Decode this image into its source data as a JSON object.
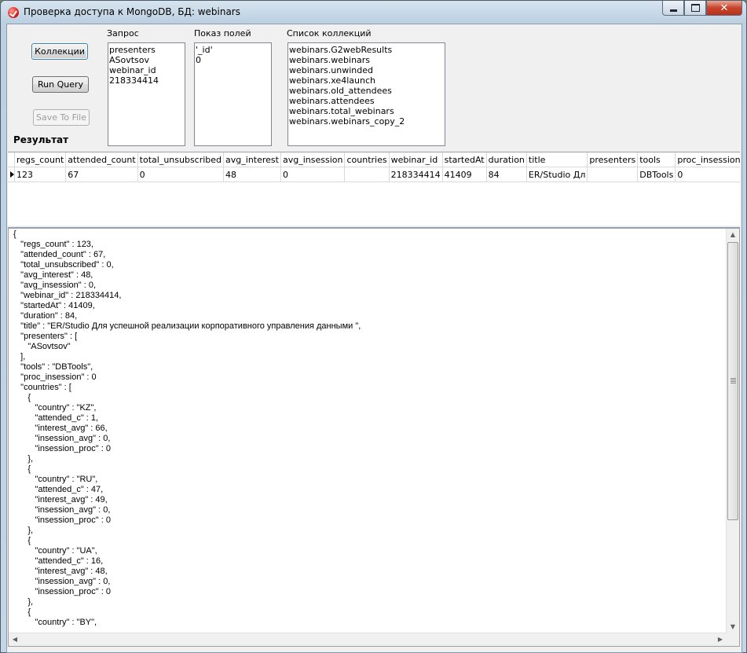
{
  "window": {
    "title": "Проверка доступа к MongoDB, БД: webinars",
    "controls": {
      "minimize_icon": "minimize-icon",
      "maximize_icon": "maximize-icon",
      "close_icon": "close-icon",
      "close_glyph": "✕"
    }
  },
  "buttons": {
    "collections": "Коллекции",
    "run_query": "Run Query",
    "save_to_file": "Save To File"
  },
  "query": {
    "label": "Запрос",
    "lines": [
      "presenters",
      "ASovtsov",
      "webinar_id",
      "218334414"
    ]
  },
  "fields": {
    "label": "Показ полей",
    "lines": [
      "'_id'",
      "0"
    ]
  },
  "collections": {
    "label": "Список  коллекций",
    "items": [
      "webinars.G2webResults",
      "webinars.webinars",
      "webinars.unwinded",
      "webinars.xe4launch",
      "webinars.old_attendees",
      "webinars.attendees",
      "webinars.total_webinars",
      "webinars.webinars_copy_2"
    ]
  },
  "result": {
    "label": "Результат",
    "columns": [
      "regs_count",
      "attended_count",
      "total_unsubscribed",
      "avg_interest",
      "avg_insession",
      "countries",
      "webinar_id",
      "startedAt",
      "duration",
      "title",
      "presenters",
      "tools",
      "proc_insession"
    ],
    "rows": [
      [
        "123",
        "67",
        "0",
        "48",
        "0",
        "",
        "218334414",
        "41409",
        "84",
        "ER/Studio Дл",
        "",
        "DBTools",
        "0"
      ]
    ]
  },
  "json_lines": [
    "{",
    "   \"regs_count\" : 123,",
    "   \"attended_count\" : 67,",
    "   \"total_unsubscribed\" : 0,",
    "   \"avg_interest\" : 48,",
    "   \"avg_insession\" : 0,",
    "   \"webinar_id\" : 218334414,",
    "   \"startedAt\" : 41409,",
    "   \"duration\" : 84,",
    "   \"title\" : \"ER/Studio Для успешной реализации корпоративного управления данными \",",
    "   \"presenters\" : [",
    "      \"ASovtsov\"",
    "   ],",
    "   \"tools\" : \"DBTools\",",
    "   \"proc_insession\" : 0",
    "   \"countries\" : [",
    "      {",
    "         \"country\" : \"KZ\",",
    "         \"attended_c\" : 1,",
    "         \"interest_avg\" : 66,",
    "         \"insession_avg\" : 0,",
    "         \"insession_proc\" : 0",
    "      },",
    "      {",
    "         \"country\" : \"RU\",",
    "         \"attended_c\" : 47,",
    "         \"interest_avg\" : 49,",
    "         \"insession_avg\" : 0,",
    "         \"insession_proc\" : 0",
    "      },",
    "      {",
    "         \"country\" : \"UA\",",
    "         \"attended_c\" : 16,",
    "         \"interest_avg\" : 48,",
    "         \"insession_avg\" : 0,",
    "         \"insession_proc\" : 0",
    "      },",
    "      {",
    "         \"country\" : \"BY\","
  ],
  "colors": {
    "title_bar": "#c4d5e5",
    "close_button": "#c7442b",
    "panel": "#f0f0f0"
  }
}
